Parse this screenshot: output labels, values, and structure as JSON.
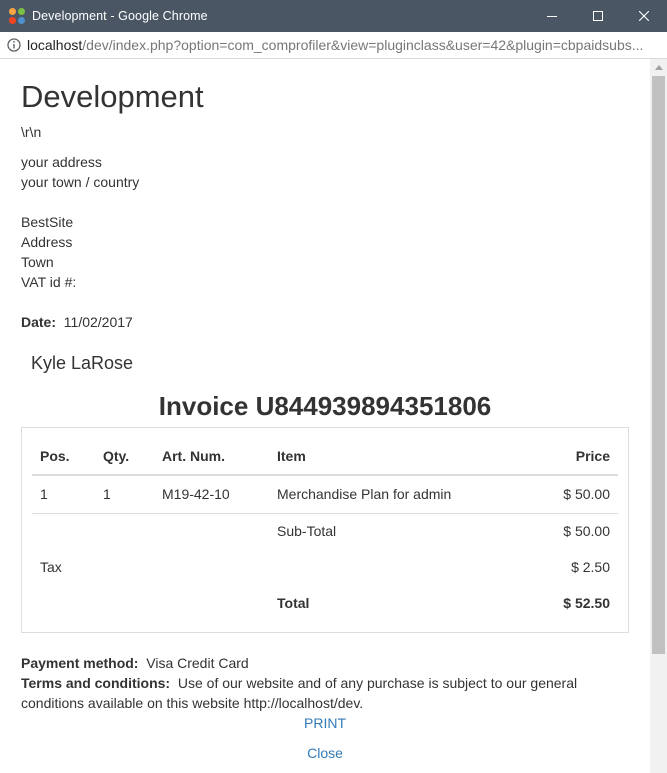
{
  "window": {
    "title": "Development - Google Chrome",
    "address_host": "localhost",
    "address_path": "/dev/index.php?option=com_comprofiler&view=pluginclass&user=42&plugin=cbpaidsubs..."
  },
  "page": {
    "title": "Development",
    "escape_text": "\\r\\n",
    "sender_address": [
      "your address",
      "your town / country"
    ],
    "recipient": [
      "BestSite",
      "Address",
      "Town",
      "VAT id #:"
    ],
    "date_label": "Date:",
    "date_value": "11/02/2017",
    "customer_name": "Kyle LaRose",
    "invoice_title": "Invoice U844939894351806"
  },
  "invoice": {
    "headers": {
      "pos": "Pos.",
      "qty": "Qty.",
      "art_num": "Art. Num.",
      "item": "Item",
      "price": "Price"
    },
    "item": {
      "pos": "1",
      "qty": "1",
      "art_num": "M19-42-10",
      "item": "Merchandise Plan for admin",
      "price": "$ 50.00"
    },
    "subtotal_label": "Sub-Total",
    "subtotal_value": "$ 50.00",
    "tax_label": "Tax",
    "tax_value": "$ 2.50",
    "total_label": "Total",
    "total_value": "$ 52.50"
  },
  "footer": {
    "payment_label": "Payment method:",
    "payment_value": "Visa Credit Card",
    "terms_label": "Terms and conditions:",
    "terms_line1": "Use of our website and of any purchase is subject to our general",
    "terms_line2": "conditions available on this website http://localhost/dev.",
    "print_label": "PRINT",
    "close_label": "Close"
  },
  "colors": {
    "titlebar": "#4a5664",
    "link": "#337ab7",
    "text": "#333333"
  }
}
